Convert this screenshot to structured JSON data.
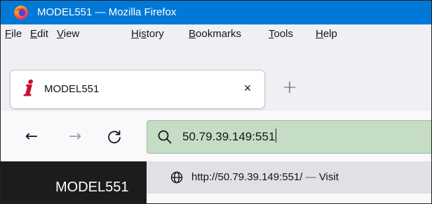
{
  "window": {
    "title": "MODEL551 — Mozilla Firefox"
  },
  "menubar": {
    "items": [
      "File",
      "Edit",
      "View",
      "History",
      "Bookmarks",
      "Tools",
      "Help"
    ]
  },
  "tab": {
    "favicon": "ℹ",
    "title": "MODEL551",
    "close": "×"
  },
  "new_tab": "+",
  "nav": {
    "back": "←",
    "forward": "→",
    "reload": "C"
  },
  "urlbar": {
    "value": "50.79.39.149:551"
  },
  "page": {
    "heading": "MODEL551"
  },
  "suggestion": {
    "url": "http://50.79.39.149:551/",
    "separator": "—",
    "action": "Visit"
  },
  "colors": {
    "titlebar": "#0078d7",
    "urlbar_bg": "#c5ddc5",
    "favicon": "#c8102e"
  }
}
